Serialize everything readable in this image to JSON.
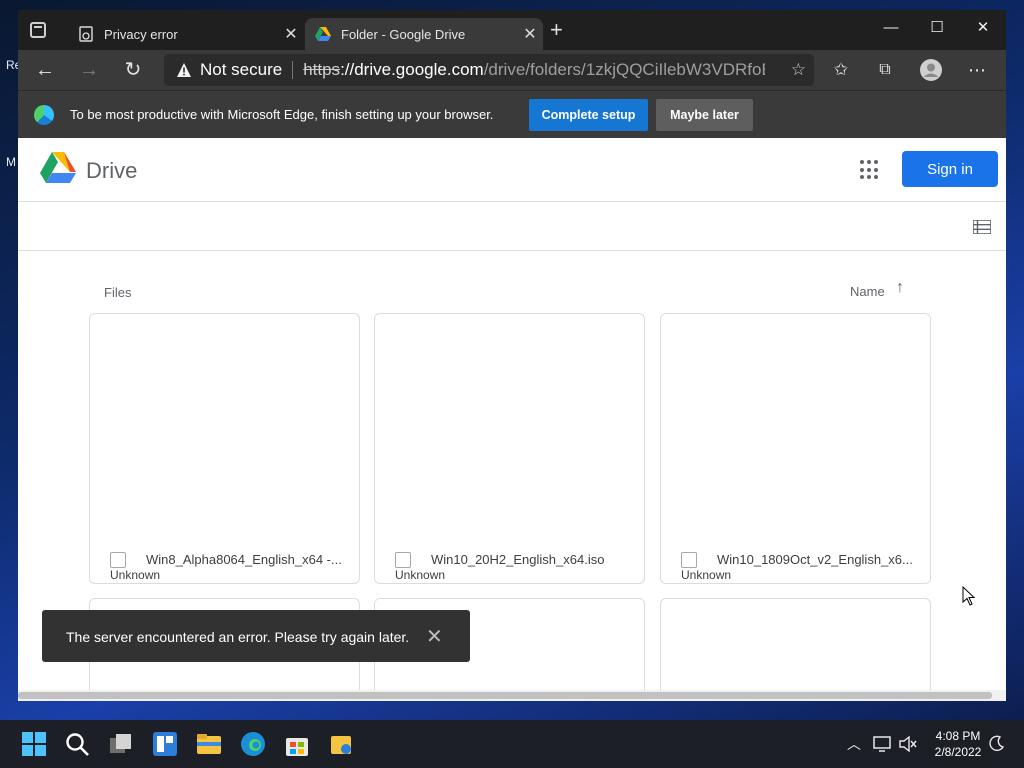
{
  "desktop": {
    "glyphs": [
      "Re",
      "M"
    ]
  },
  "tabs": [
    {
      "label": "Privacy error",
      "close": "✕"
    },
    {
      "label": "Folder - Google Drive",
      "close": "✕"
    }
  ],
  "toolbar": {
    "security_label": "Not secure",
    "url_scheme": "https",
    "url_host": "://drive.google.com",
    "url_path": "/drive/folders/1zkjQQCiIlebW3VDRfoB..."
  },
  "infobar": {
    "message": "To be most productive with Microsoft Edge, finish setting up your browser.",
    "complete_label": "Complete setup",
    "later_label": "Maybe later"
  },
  "drive": {
    "title": "Drive",
    "signin_label": "Sign in",
    "files_label": "Files",
    "sort_label": "Name",
    "sort_arrow": "↑",
    "files": [
      {
        "name": "Win8_Alpha8064_English_x64 -...",
        "type": "Unknown"
      },
      {
        "name": "Win10_20H2_English_x64.iso",
        "type": "Unknown"
      },
      {
        "name": "Win10_1809Oct_v2_English_x6...",
        "type": "Unknown"
      }
    ]
  },
  "toast": {
    "message": "The server encountered an error. Please try again later.",
    "close": "✕"
  },
  "taskbar": {
    "time": "4:08 PM",
    "date": "2/8/2022"
  },
  "colors": {
    "drive_blue": "#1a73e8",
    "edge_blue": "#1677d2",
    "toast_bg": "#323232"
  }
}
